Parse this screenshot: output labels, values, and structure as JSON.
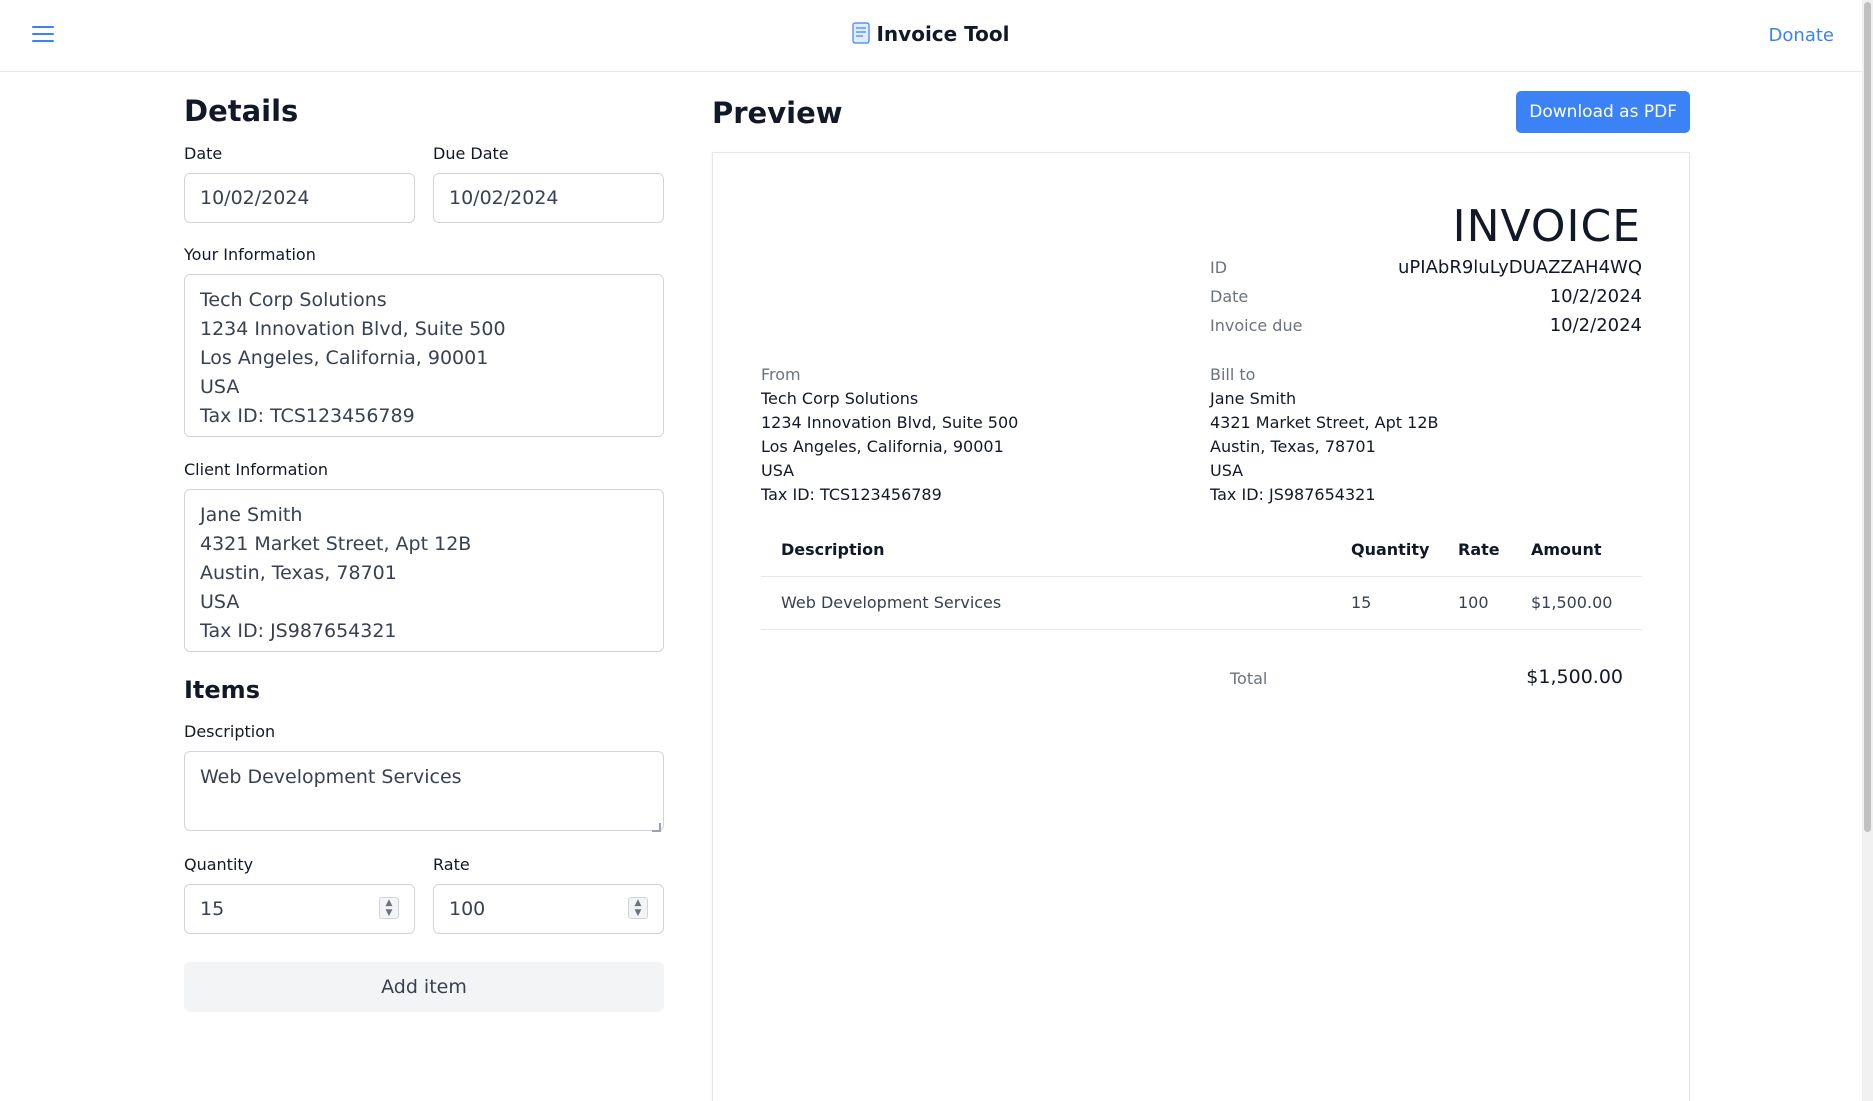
{
  "header": {
    "title": "Invoice Tool",
    "donate_label": "Donate"
  },
  "form": {
    "heading": "Details",
    "date_label": "Date",
    "date_value": "10/02/2024",
    "due_date_label": "Due Date",
    "due_date_value": "10/02/2024",
    "your_info_label": "Your Information",
    "your_info_value": "Tech Corp Solutions\n1234 Innovation Blvd, Suite 500\nLos Angeles, California, 90001\nUSA\nTax ID: TCS123456789",
    "client_info_label": "Client Information",
    "client_info_value": "Jane Smith\n4321 Market Street, Apt 12B\nAustin, Texas, 78701\nUSA\nTax ID: JS987654321",
    "items_heading": "Items",
    "description_label": "Description",
    "description_value": "Web Development Services",
    "quantity_label": "Quantity",
    "quantity_value": "15",
    "rate_label": "Rate",
    "rate_value": "100",
    "add_item_label": "Add item"
  },
  "preview": {
    "heading": "Preview",
    "download_label": "Download as PDF",
    "invoice_title": "INVOICE",
    "id_label": "ID",
    "id_value": "uPIAbR9luLyDUAZZAH4WQ",
    "date_label": "Date",
    "date_value": "10/2/2024",
    "due_label": "Invoice due",
    "due_value": "10/2/2024",
    "from_label": "From",
    "from_lines": [
      "Tech Corp Solutions",
      "1234 Innovation Blvd, Suite 500",
      "Los Angeles, California, 90001",
      "USA",
      "Tax ID: TCS123456789"
    ],
    "billto_label": "Bill to",
    "billto_lines": [
      "Jane Smith",
      "4321 Market Street, Apt 12B",
      "Austin, Texas, 78701",
      "USA",
      "Tax ID: JS987654321"
    ],
    "table": {
      "headers": [
        "Description",
        "Quantity",
        "Rate",
        "Amount"
      ],
      "rows": [
        [
          "Web Development Services",
          "15",
          "100",
          "$1,500.00"
        ]
      ]
    },
    "total_label": "Total",
    "total_value": "$1,500.00"
  },
  "colors": {
    "accent": "#3b82f6",
    "border": "#d1d5db",
    "muted_text": "#6b7280"
  },
  "icons": [
    "menu-icon",
    "invoice-icon",
    "stepper-icon"
  ]
}
